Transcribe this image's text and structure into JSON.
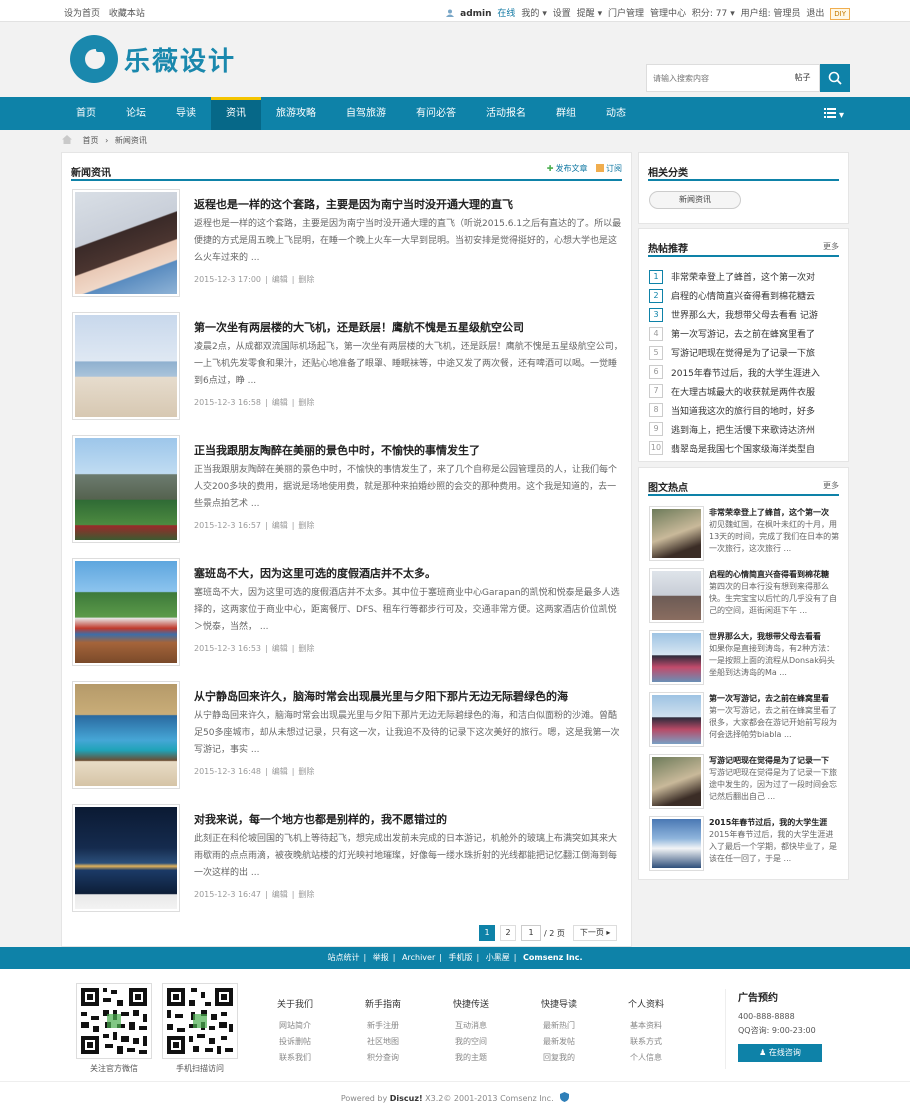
{
  "topbar": {
    "set_home": "设为首页",
    "bookmark": "收藏本站",
    "username": "admin",
    "online": "在线",
    "my": "我的",
    "settings": "设置",
    "remind": "提醒",
    "portal_admin": "门户管理",
    "admin_center": "管理中心",
    "points": "积分: 77",
    "group": "用户组: 管理员",
    "logout": "退出",
    "diy": "DIY"
  },
  "header": {
    "logo_text": "乐薇设计",
    "search_placeholder": "请输入搜索内容",
    "search_type": "帖子"
  },
  "nav": {
    "items": [
      "首页",
      "论坛",
      "导读",
      "资讯",
      "旅游攻略",
      "自驾旅游",
      "有问必答",
      "活动报名",
      "群组",
      "动态"
    ],
    "active_index": 3
  },
  "breadcrumb": {
    "home": "首页",
    "sep": "›",
    "current": "新闻资讯"
  },
  "main": {
    "title": "新闻资讯",
    "publish": "发布文章",
    "subscribe": "订阅",
    "meta_sep": "|",
    "edit": "编辑",
    "delete": "删除",
    "posts": [
      {
        "title": "返程也是一样的这个套路，主要是因为南宁当时没开通大理的直飞",
        "excerpt": "返程也是一样的这个套路，主要是因为南宁当时没开通大理的直飞（听说2015.6.1之后有直达的了。所以最便捷的方式是周五晚上飞昆明，在睡一个晚上火车一大早到昆明。当初安排是觉得挺好的，心想大学也是这么火车过来的 ...",
        "date": "2015-12-3 17:00"
      },
      {
        "title": "第一次坐有两层楼的大飞机，还是跃层！鹰航不愧是五星级航空公司",
        "excerpt": "凌晨2点，从成都双流国际机场起飞，第一次坐有两层楼的大飞机，还是跃层！鹰航不愧是五星级航空公司，一上飞机先发零食和果汁，还贴心地准备了眼罩、睡眠袜等，中途又发了两次餐，还有啤酒可以喝。一觉睡到6点过，睁 ...",
        "date": "2015-12-3 16:58"
      },
      {
        "title": "正当我跟朋友陶醉在美丽的景色中时，不愉快的事情发生了",
        "excerpt": "正当我跟朋友陶醉在美丽的景色中时，不愉快的事情发生了，来了几个自称是公园管理员的人，让我们每个人交200多块的费用，据说是场地使用费，就是那种来拍婚纱照的会交的那种费用。这个我是知道的，去一些景点拍艺术 ...",
        "date": "2015-12-3 16:57"
      },
      {
        "title": "塞班岛不大，因为这里可选的度假酒店并不太多。",
        "excerpt": "塞班岛不大，因为这里可选的度假酒店并不太多。其中位于塞班商业中心Garapan的凯悦和悦泰是最多人选择的，这两家位于商业中心，距离餐厅、DFS、租车行等都步行可及，交通非常方便。这两家酒店价位凯悦＞悦泰，当然， ...",
        "date": "2015-12-3 16:53"
      },
      {
        "title": "从宁静岛回来许久，脑海时常会出现晨光里与夕阳下那片无边无际碧绿色的海",
        "excerpt": "从宁静岛回来许久，脑海时常会出现晨光里与夕阳下那片无边无际碧绿色的海，和洁白似面粉的沙滩。曾酷足50多座城市，却从未想过记录，只有这一次，让我迫不及待的记录下这次美好的旅行。嗯，这是我第一次写游记，事实 ...",
        "date": "2015-12-3 16:48"
      },
      {
        "title": "对我来说，每一个地方也都是别样的，我不愿错过的",
        "excerpt": "此刻正在科伦坡回国的飞机上等待起飞，想完成出发前未完成的日本游记，机舱外的玻璃上布满突如其来大雨歇雨的点点雨滴，被夜晚航站楼的灯光映衬地璀璨，好像每一缕水珠折射的光线都能把记忆翻江倒海到每一次这样的出 ...",
        "date": "2015-12-3 16:47"
      }
    ],
    "pager": {
      "pages": [
        "1",
        "2"
      ],
      "current": "1",
      "input": "1",
      "total": "/ 2 页",
      "next": "下一页"
    }
  },
  "sidebar": {
    "category": {
      "title": "相关分类",
      "item": "新闻资讯"
    },
    "hot": {
      "title": "热帖推荐",
      "more": "更多",
      "items": [
        {
          "n": "1",
          "t": "非常荣幸登上了蜂首，这个第一次对"
        },
        {
          "n": "2",
          "t": "启程的心情简直兴奋得看到棉花糖云"
        },
        {
          "n": "3",
          "t": "世界那么大，我想带父母去看看 记游"
        },
        {
          "n": "4",
          "t": "第一次写游记，去之前在蜂窝里看了"
        },
        {
          "n": "5",
          "t": "写游记吧现在觉得是为了记录一下旅"
        },
        {
          "n": "6",
          "t": "2015年春节过后，我的大学生涯进入"
        },
        {
          "n": "7",
          "t": "在大理古城最大的收获就是两件衣服"
        },
        {
          "n": "8",
          "t": "当知道我这次的旅行目的地时，好多"
        },
        {
          "n": "9",
          "t": "逃到海上，把生活慢下来歌诗达济州"
        },
        {
          "n": "10",
          "t": "翡翠岛是我国七个国家级海洋类型自"
        }
      ]
    },
    "pics": {
      "title": "图文热点",
      "more": "更多",
      "items": [
        {
          "t": "非常荣幸登上了蜂首，这个第一次",
          "d": "初见魏虹国，在枫叶未红的十月，用13天的时间，完成了我们在日本的第一次旅行，这次旅行 ..."
        },
        {
          "t": "启程的心情简直兴奋得看到棉花糖",
          "d": "第四次的日本行没有想到来得那么快。生完宝宝以后忙的几乎没有了自己的空间，逛街闲逛下午 ..."
        },
        {
          "t": "世界那么大，我想带父母去看看",
          "d": "如果你是直接到涛岛，有2种方法：一是按照上面的流程从Donsak码头坐船到达涛岛的Ma ..."
        },
        {
          "t": "第一次写游记，去之前在蜂窝里看",
          "d": "第一次写游记，去之前在蜂窝里看了很多，大家都会在游记开始前写段为何会选择帕劳biabla ..."
        },
        {
          "t": "写游记吧现在觉得是为了记录一下",
          "d": "写游记吧现在觉得是为了记录一下旅途中发生的，因为过了一段时间会忘记然后翻出自己 ..."
        },
        {
          "t": "2015年春节过后，我的大学生涯",
          "d": "2015年春节过后，我的大学生涯进入了最后一个学期，都快毕业了，是该在任一回了，于是 ..."
        }
      ]
    }
  },
  "footer_bar": {
    "links": [
      "站点统计",
      "举报",
      "Archiver",
      "手机版",
      "小黑屋",
      "Comsenz Inc."
    ],
    "sep": "|"
  },
  "footer": {
    "qr": [
      {
        "label": "关注官方微信"
      },
      {
        "label": "手机扫描访问"
      }
    ],
    "cols": [
      {
        "h": "关于我们",
        "l": [
          "网站简介",
          "投诉删帖",
          "联系我们"
        ]
      },
      {
        "h": "新手指南",
        "l": [
          "新手注册",
          "社区地图",
          "积分查询"
        ]
      },
      {
        "h": "快捷传送",
        "l": [
          "互动消息",
          "我的空间",
          "我的主题"
        ]
      },
      {
        "h": "快捷导读",
        "l": [
          "最新热门",
          "最新发帖",
          "回复我的"
        ]
      },
      {
        "h": "个人资料",
        "l": [
          "基本资料",
          "联系方式",
          "个人信息"
        ]
      }
    ],
    "ad": {
      "h": "广告预约",
      "phone": "400-888-8888",
      "qq": "QQ咨询: 9:00-23:00",
      "btn": "在线咨询"
    },
    "copy_pre": "Powered by",
    "copy_brand": "Discuz!",
    "copy_rest": "X3.2© 2001-2013 Comsenz Inc."
  }
}
